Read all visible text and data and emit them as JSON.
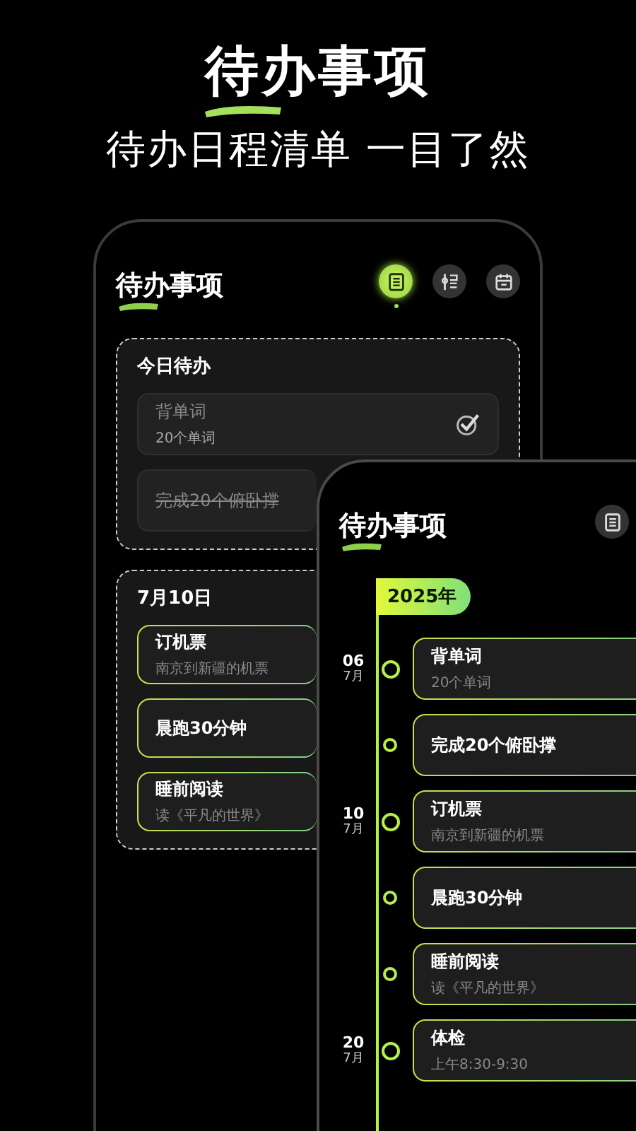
{
  "headline": {
    "title": "待办事项",
    "subtitle": "待办日程清单 一目了然"
  },
  "back_screen": {
    "title": "待办事项",
    "view_tabs": [
      {
        "kind": "list",
        "selected": true
      },
      {
        "kind": "timeline",
        "selected": false
      },
      {
        "kind": "calendar",
        "selected": false
      }
    ],
    "today": {
      "label": "今日待办",
      "items": [
        {
          "title": "背单词",
          "subtitle": "20个单词",
          "done": true,
          "strikethrough": false,
          "checked": true
        },
        {
          "title": "完成20个俯卧撑",
          "done": true,
          "strikethrough": true
        }
      ]
    },
    "day_group": {
      "label": "7月10日",
      "items": [
        {
          "title": "订机票",
          "subtitle": "南京到新疆的机票"
        },
        {
          "title": "晨跑30分钟"
        },
        {
          "title": "睡前阅读",
          "subtitle": "读《平凡的世界》"
        }
      ]
    }
  },
  "front_screen": {
    "title": "待办事项",
    "view_tab": {
      "kind": "list",
      "selected": false
    },
    "year": "2025年",
    "entries": [
      {
        "day": "06",
        "month": "7月",
        "title": "背单词",
        "subtitle": "20个单词"
      },
      {
        "title": "完成20个俯卧撑"
      },
      {
        "day": "10",
        "month": "7月",
        "title": "订机票",
        "subtitle": "南京到新疆的机票"
      },
      {
        "title": "晨跑30分钟"
      },
      {
        "title": "睡前阅读",
        "subtitle": "读《平凡的世界》"
      },
      {
        "day": "20",
        "month": "7月",
        "title": "体检",
        "subtitle": "上午8:30-9:30"
      }
    ]
  }
}
